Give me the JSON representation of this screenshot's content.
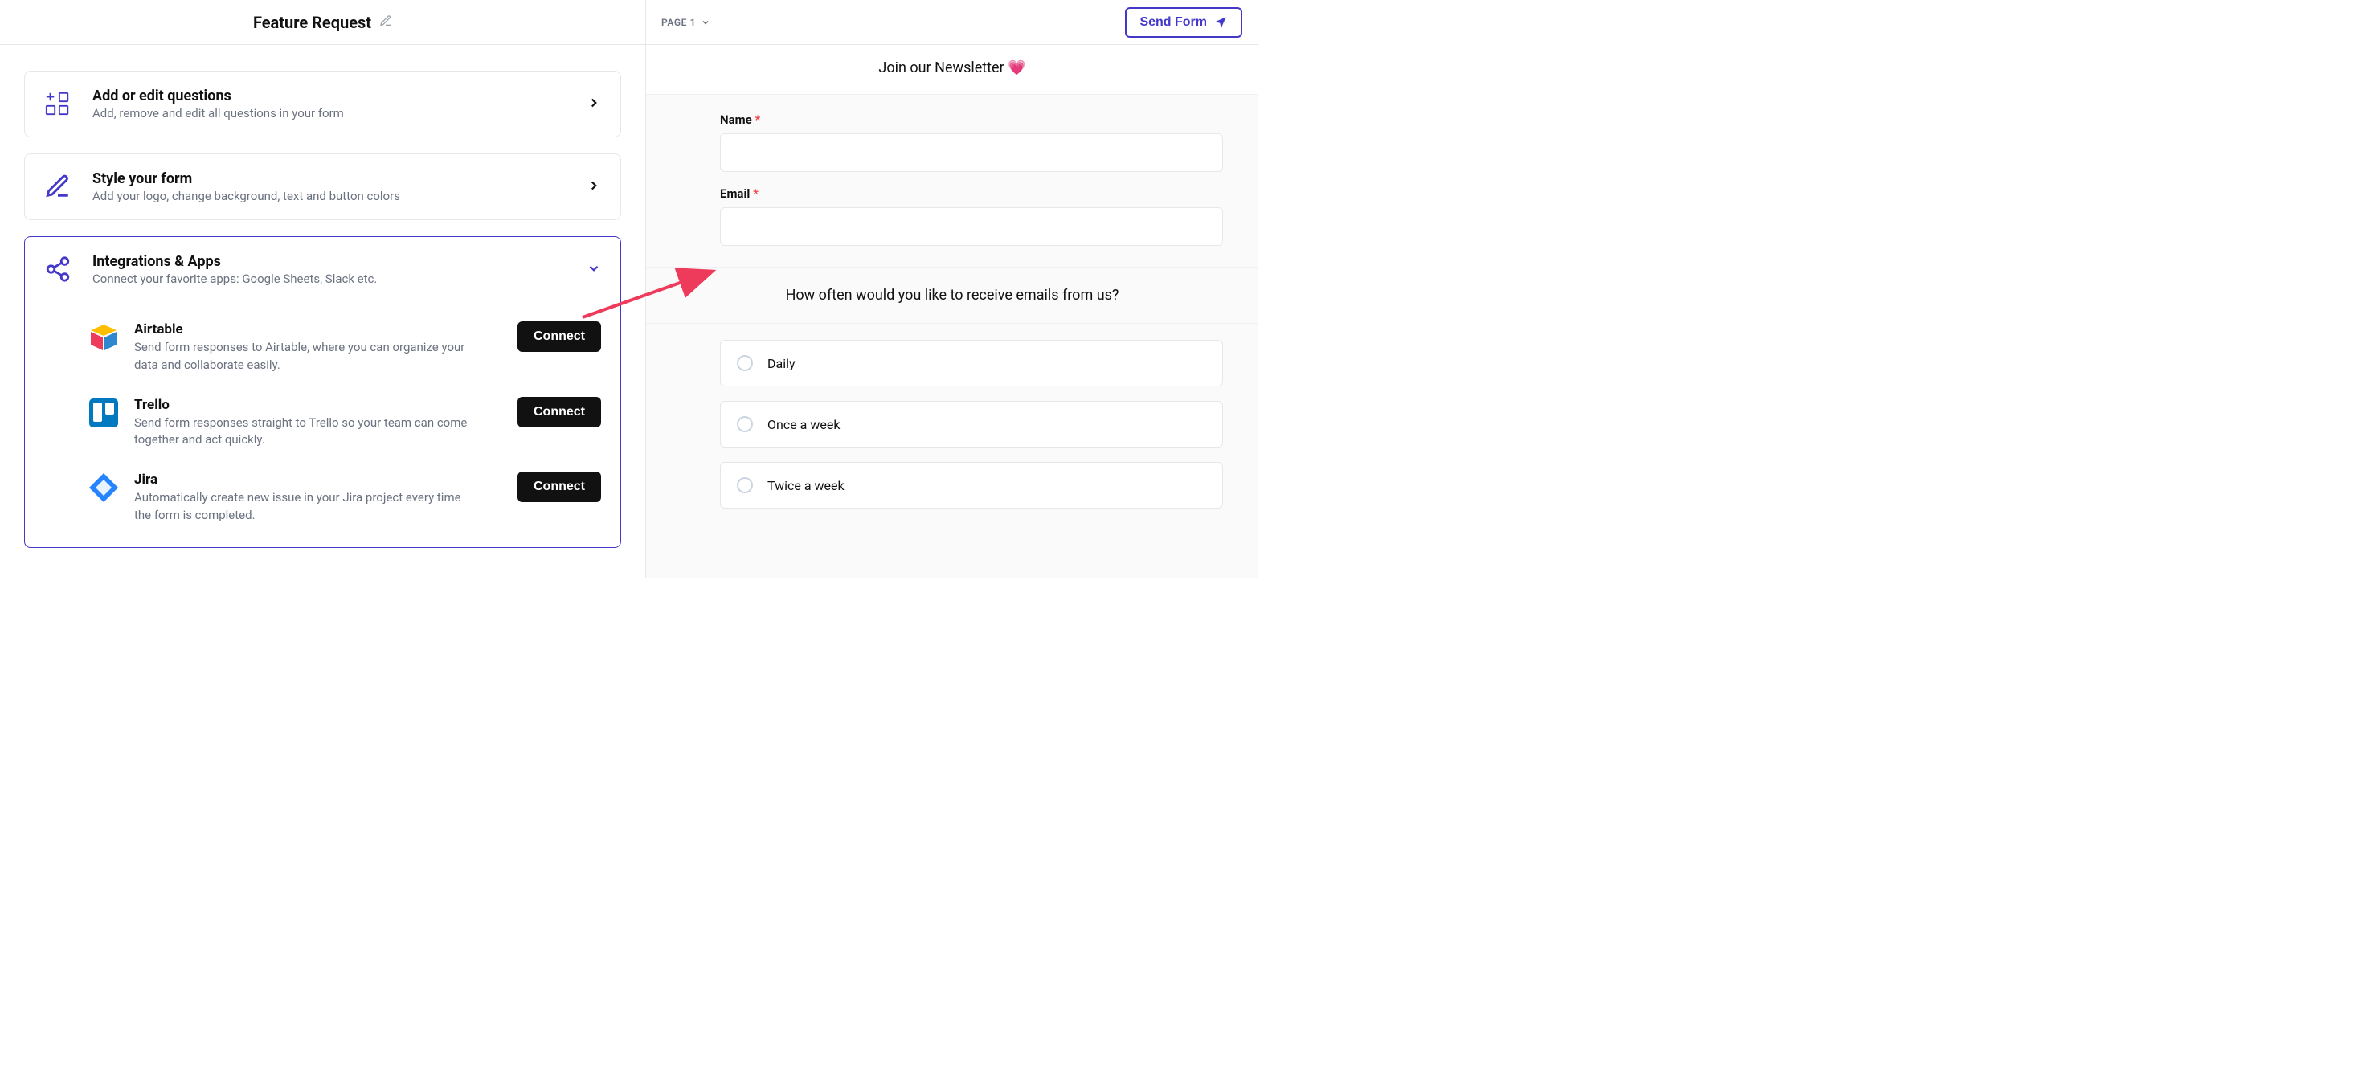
{
  "header": {
    "title": "Feature Request",
    "page_label": "PAGE 1",
    "send_label": "Send Form"
  },
  "cards": {
    "add_questions": {
      "title": "Add or edit questions",
      "subtitle": "Add, remove and edit all questions in your form"
    },
    "style_form": {
      "title": "Style your form",
      "subtitle": "Add your logo, change background, text and button colors"
    },
    "integrations": {
      "title": "Integrations & Apps",
      "subtitle": "Connect your favorite apps: Google Sheets, Slack etc."
    }
  },
  "integrations": [
    {
      "name": "Airtable",
      "description": "Send form responses to Airtable, where you can organize your data and collaborate easily.",
      "action": "Connect"
    },
    {
      "name": "Trello",
      "description": "Send form responses straight to Trello so your team can come together and act quickly.",
      "action": "Connect"
    },
    {
      "name": "Jira",
      "description": "Automatically create new issue in your Jira project every time the form is completed.",
      "action": "Connect"
    }
  ],
  "preview": {
    "heading": "Join our Newsletter 💗",
    "fields": {
      "name_label": "Name",
      "email_label": "Email"
    },
    "question": "How often would you like to receive emails from us?",
    "options": [
      {
        "label": "Daily"
      },
      {
        "label": "Once a week"
      },
      {
        "label": "Twice a week"
      }
    ]
  }
}
